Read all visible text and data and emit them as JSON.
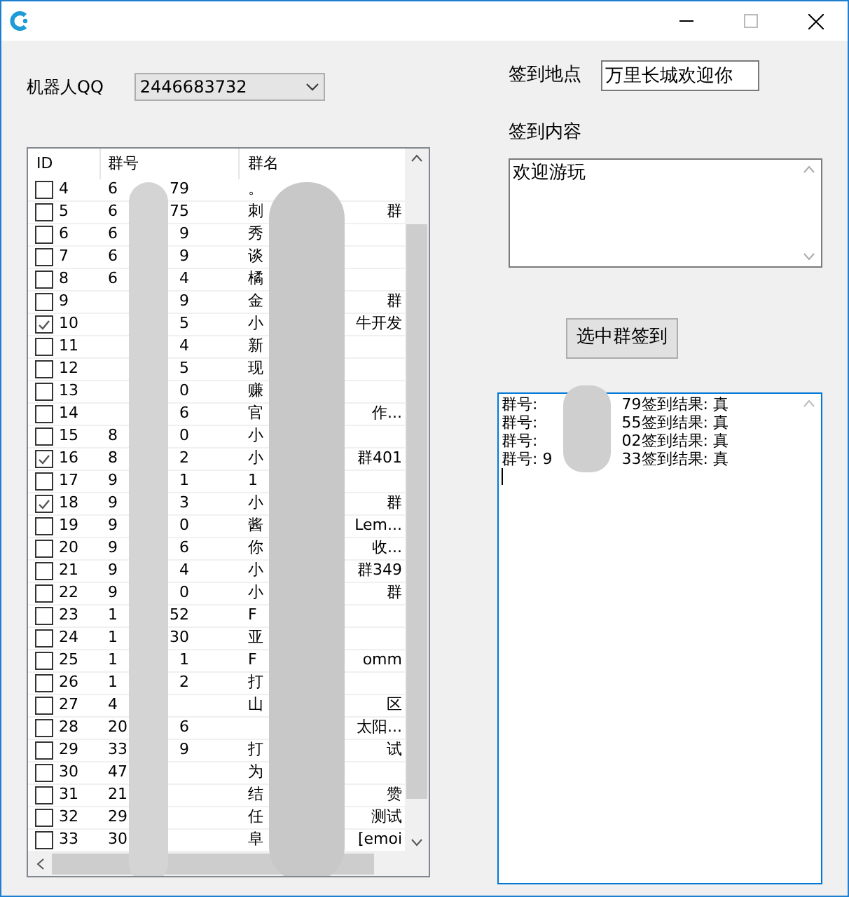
{
  "robot": {
    "label": "机器人QQ",
    "value": "2446683732"
  },
  "place": {
    "label": "签到地点",
    "value": "万里长城欢迎你"
  },
  "content": {
    "label": "签到内容",
    "value": "欢迎游玩"
  },
  "button": "选中群签到",
  "table": {
    "columns": [
      "ID",
      "群号",
      "群名"
    ],
    "rows": [
      {
        "id": "4",
        "checked": false,
        "num_a": "6",
        "num_b": "79",
        "name_a": "。",
        "name_b": ""
      },
      {
        "id": "5",
        "checked": false,
        "num_a": "6",
        "num_b": "75",
        "name_a": "刺",
        "name_b": "群"
      },
      {
        "id": "6",
        "checked": false,
        "num_a": "6",
        "num_b": "9",
        "name_a": "秀",
        "name_b": ""
      },
      {
        "id": "7",
        "checked": false,
        "num_a": "6",
        "num_b": "9",
        "name_a": "谈",
        "name_b": ""
      },
      {
        "id": "8",
        "checked": false,
        "num_a": "6",
        "num_b": "4",
        "name_a": "橘",
        "name_b": ""
      },
      {
        "id": "9",
        "checked": false,
        "num_a": "",
        "num_b": "9",
        "name_a": "金",
        "name_b": "群"
      },
      {
        "id": "10",
        "checked": true,
        "num_a": "",
        "num_b": "5",
        "name_a": "小",
        "name_b": "牛开发"
      },
      {
        "id": "11",
        "checked": false,
        "num_a": "",
        "num_b": "4",
        "name_a": "新",
        "name_b": ""
      },
      {
        "id": "12",
        "checked": false,
        "num_a": "",
        "num_b": "5",
        "name_a": "现",
        "name_b": ""
      },
      {
        "id": "13",
        "checked": false,
        "num_a": "",
        "num_b": "0",
        "name_a": "赚",
        "name_b": ""
      },
      {
        "id": "14",
        "checked": false,
        "num_a": "",
        "num_b": "6",
        "name_a": "官",
        "name_b": "作..."
      },
      {
        "id": "15",
        "checked": false,
        "num_a": "8",
        "num_b": "0",
        "name_a": "小",
        "name_b": ""
      },
      {
        "id": "16",
        "checked": true,
        "num_a": "8",
        "num_b": "2",
        "name_a": "小",
        "name_b": "群401"
      },
      {
        "id": "17",
        "checked": false,
        "num_a": "9",
        "num_b": "1",
        "name_a": "1",
        "name_b": ""
      },
      {
        "id": "18",
        "checked": true,
        "num_a": "9",
        "num_b": "3",
        "name_a": "小",
        "name_b": "群"
      },
      {
        "id": "19",
        "checked": false,
        "num_a": "9",
        "num_b": "0",
        "name_a": "酱",
        "name_b": "Lem..."
      },
      {
        "id": "20",
        "checked": false,
        "num_a": "9",
        "num_b": "6",
        "name_a": "你",
        "name_b": "收..."
      },
      {
        "id": "21",
        "checked": false,
        "num_a": "9",
        "num_b": "4",
        "name_a": "小",
        "name_b": "群349"
      },
      {
        "id": "22",
        "checked": false,
        "num_a": "9",
        "num_b": "0",
        "name_a": "小",
        "name_b": "群"
      },
      {
        "id": "23",
        "checked": false,
        "num_a": "1",
        "num_b": "52",
        "name_a": "F",
        "name_b": ""
      },
      {
        "id": "24",
        "checked": false,
        "num_a": "1",
        "num_b": "30",
        "name_a": "亚",
        "name_b": ""
      },
      {
        "id": "25",
        "checked": false,
        "num_a": "1",
        "num_b": "1",
        "name_a": "F",
        "name_b": "omm"
      },
      {
        "id": "26",
        "checked": false,
        "num_a": "1",
        "num_b": "2",
        "name_a": "打",
        "name_b": ""
      },
      {
        "id": "27",
        "checked": false,
        "num_a": "4",
        "num_b": "",
        "name_a": "山",
        "name_b": "区"
      },
      {
        "id": "28",
        "checked": false,
        "num_a": "20",
        "num_b": "6",
        "name_a": "",
        "name_b": "太阳..."
      },
      {
        "id": "29",
        "checked": false,
        "num_a": "33",
        "num_b": "9",
        "name_a": "打",
        "name_b": "试"
      },
      {
        "id": "30",
        "checked": false,
        "num_a": "47",
        "num_b": "",
        "name_a": "为",
        "name_b": ""
      },
      {
        "id": "31",
        "checked": false,
        "num_a": "21",
        "num_b": "",
        "name_a": "结",
        "name_b": "赞"
      },
      {
        "id": "32",
        "checked": false,
        "num_a": "29",
        "num_b": "",
        "name_a": "任",
        "name_b": "测试"
      },
      {
        "id": "33",
        "checked": false,
        "num_a": "30",
        "num_b": "",
        "name_a": "阜",
        "name_b": "[emoi"
      }
    ]
  },
  "log": [
    {
      "prefix": "群号: ",
      "suffix": "79签到结果: 真"
    },
    {
      "prefix": "群号: ",
      "suffix": "55签到结果: 真"
    },
    {
      "prefix": "群号: ",
      "suffix": "02签到结果: 真"
    },
    {
      "prefix": "群号: 9",
      "suffix": "33签到结果: 真"
    }
  ]
}
